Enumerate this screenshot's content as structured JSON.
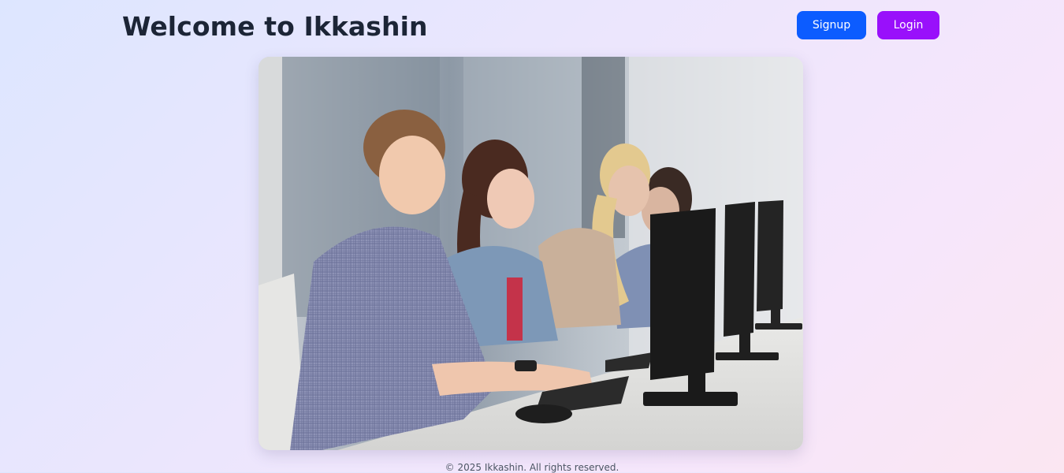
{
  "header": {
    "title": "Welcome to Ikkashin",
    "signup_label": "Signup",
    "login_label": "Login"
  },
  "hero": {
    "image_subject": "students-at-computers-photo"
  },
  "footer": {
    "copyright": "© 2025 Ikkashin. All rights reserved."
  },
  "colors": {
    "signup_button": "#0c5cff",
    "login_button": "#9910fb",
    "title_text": "#1c2536"
  }
}
